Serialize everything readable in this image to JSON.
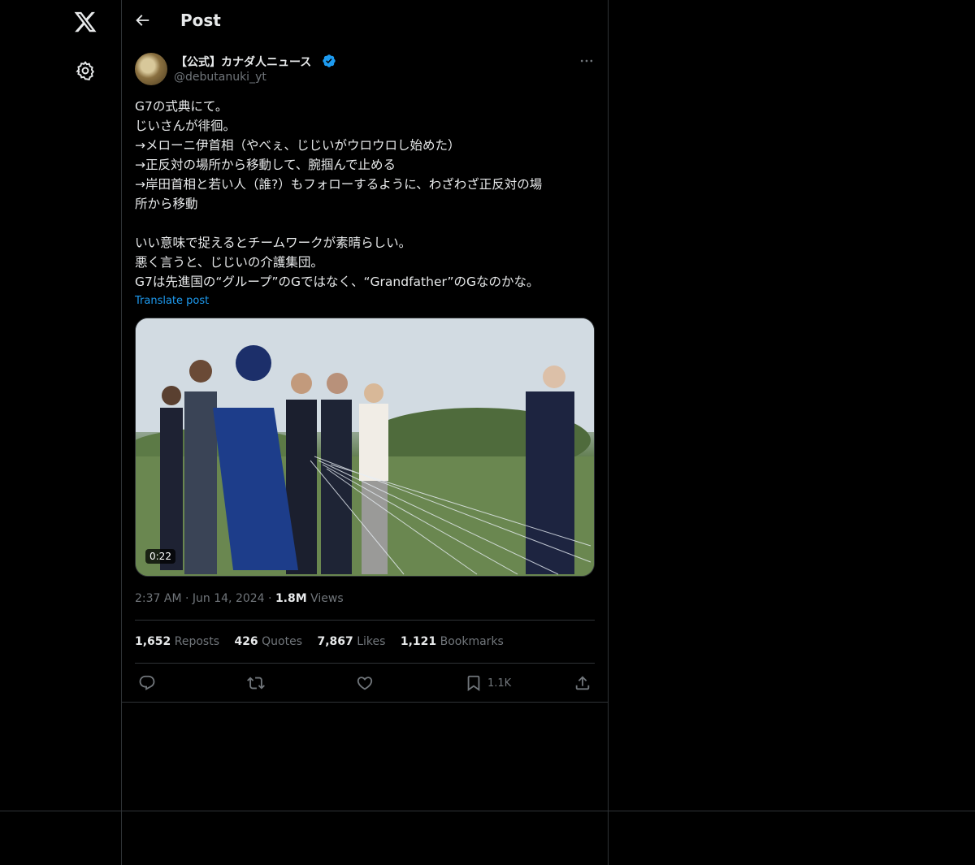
{
  "header": {
    "title": "Post"
  },
  "author": {
    "display_name": "【公式】カナダ人ニュース",
    "handle": "@debutanuki_yt"
  },
  "post": {
    "lines": [
      "G7の式典にて。",
      "じいさんが徘徊。",
      "→メローニ伊首相（やべぇ、じじいがウロウロし始めた）",
      "→正反対の場所から移動して、腕掴んで止める",
      "→岸田首相と若い人（誰?）もフォローするように、わざわざ正反対の場",
      "所から移動",
      "",
      "いい意味で捉えるとチームワークが素晴らしい。",
      "悪く言うと、じじいの介護集団。",
      "G7は先進国の“グループ”のGではなく、“Grandfather”のGなのかな。"
    ],
    "translate_label": "Translate post",
    "video_duration": "0:22",
    "time": "2:37 AM",
    "date": "Jun 14, 2024",
    "views_count": "1.8M",
    "views_label": "Views"
  },
  "stats": {
    "reposts": {
      "count": "1,652",
      "label": "Reposts"
    },
    "quotes": {
      "count": "426",
      "label": "Quotes"
    },
    "likes": {
      "count": "7,867",
      "label": "Likes"
    },
    "bookmarks": {
      "count": "1,121",
      "label": "Bookmarks"
    }
  },
  "actions": {
    "bookmark_count": "1.1K"
  },
  "icons": [
    "x-logo-icon",
    "gear-icon",
    "back-arrow-icon",
    "verified-badge-icon",
    "more-icon",
    "reply-icon",
    "repost-icon",
    "like-icon",
    "bookmark-icon",
    "share-icon"
  ],
  "colors": {
    "accent": "#1d9bf0",
    "muted": "#71767b",
    "text": "#e7e9ea",
    "border": "#2f3336"
  }
}
